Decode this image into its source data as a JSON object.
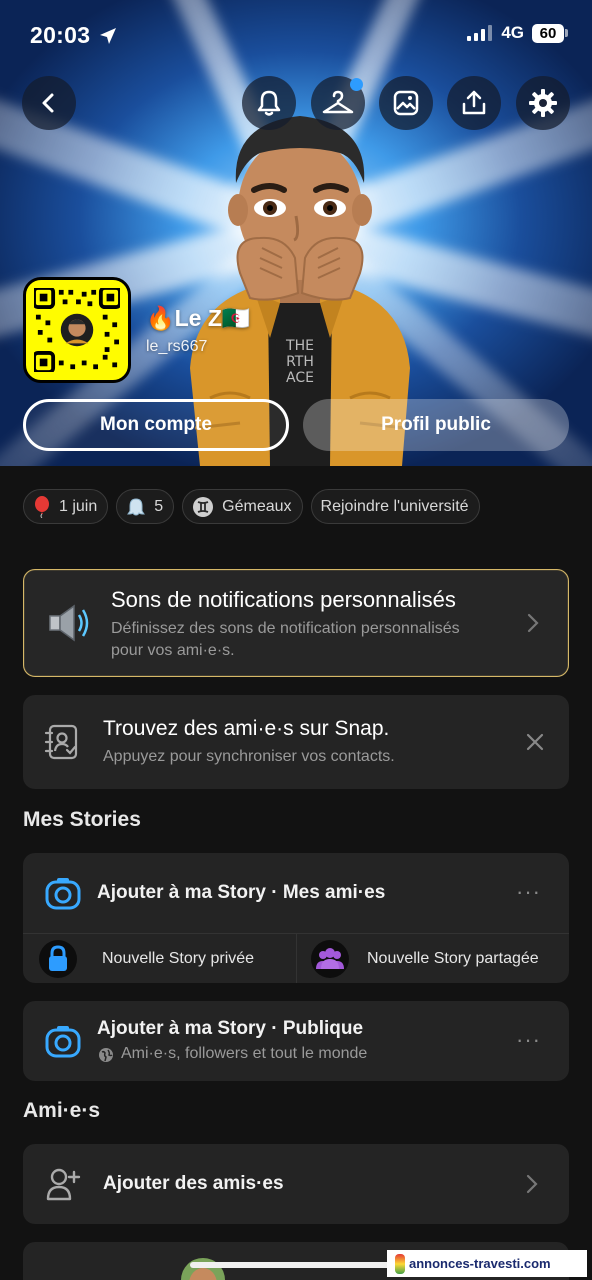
{
  "status_bar": {
    "time": "20:03",
    "network": "4G",
    "battery": "60"
  },
  "header": {
    "icons": [
      "back-icon",
      "bell-icon",
      "hanger-icon",
      "photo-icon",
      "share-icon",
      "gear-icon"
    ]
  },
  "profile": {
    "display_name": "🔥Le Z🇩🇿",
    "username": "le_rs667",
    "buttons": {
      "account": "Mon compte",
      "public": "Profil public"
    }
  },
  "chips": [
    {
      "icon": "balloon-icon",
      "label": "1 juin"
    },
    {
      "icon": "ghost-icon",
      "label": "5"
    },
    {
      "icon": "gemini-icon",
      "label": "Gémeaux"
    },
    {
      "icon": "",
      "label": "Rejoindre l'université"
    }
  ],
  "notification_card": {
    "title": "Sons de notifications personnalisés",
    "subtitle_line1": "Définissez des sons de notification personnalisés",
    "subtitle_line2": "pour vos ami·e·s."
  },
  "find_friends_card": {
    "title": "Trouvez des ami·e·s sur Snap.",
    "subtitle": "Appuyez pour synchroniser vos contacts."
  },
  "my_stories": {
    "section_title": "Mes Stories",
    "add_story_friends": "Ajouter à ma Story · Mes ami·es",
    "private_story": "Nouvelle Story privée",
    "shared_story": "Nouvelle Story partagée",
    "add_story_public": "Ajouter à ma Story · Publique",
    "public_subtitle": "Ami·e·s, followers et tout le monde",
    "more": "···"
  },
  "friends": {
    "section_title": "Ami·e·s",
    "add_friends": "Ajouter des amis·es"
  },
  "watermark": "annonces-travesti.com",
  "colors": {
    "snap_yellow": "#fffc00",
    "accent_blue": "#2d9cff",
    "notif_border": "#d6b868",
    "background": "#121212",
    "card": "#242424"
  }
}
